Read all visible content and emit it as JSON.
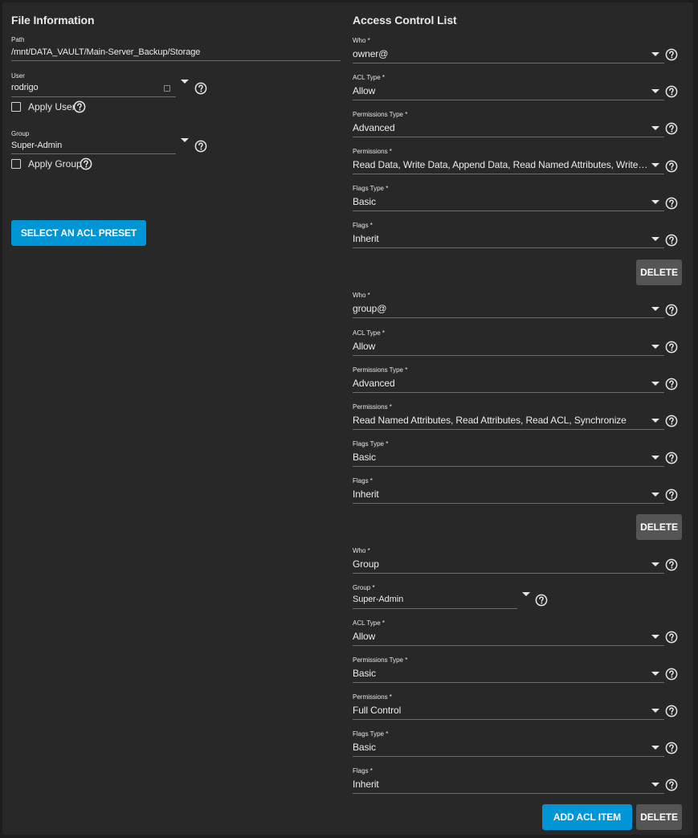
{
  "file_info": {
    "title": "File Information",
    "path_label": "Path",
    "path_value": "/mnt/DATA_VAULT/Main-Server_Backup/Storage",
    "user_label": "User",
    "user_value": "rodrigo",
    "apply_user_label": "Apply User",
    "group_label": "Group",
    "group_value": "Super-Admin",
    "apply_group_label": "Apply Group",
    "preset_button": "SELECT AN ACL PRESET"
  },
  "acl": {
    "title": "Access Control List",
    "labels": {
      "who": "Who *",
      "acl_type": "ACL Type *",
      "perm_type": "Permissions Type *",
      "perms": "Permissions *",
      "flags_type": "Flags Type *",
      "flags": "Flags *",
      "group": "Group *"
    },
    "entries": [
      {
        "who": "owner@",
        "acl_type": "Allow",
        "perm_type": "Advanced",
        "perms": "Read Data, Write Data, Append Data, Read Named Attributes, Write Named Attributes",
        "flags_type": "Basic",
        "flags": "Inherit"
      },
      {
        "who": "group@",
        "acl_type": "Allow",
        "perm_type": "Advanced",
        "perms": "Read Named Attributes, Read Attributes, Read ACL, Synchronize",
        "flags_type": "Basic",
        "flags": "Inherit"
      },
      {
        "who": "Group",
        "group": "Super-Admin",
        "acl_type": "Allow",
        "perm_type": "Basic",
        "perms": "Full Control",
        "flags_type": "Basic",
        "flags": "Inherit"
      }
    ],
    "delete_button": "DELETE",
    "add_button": "ADD ACL ITEM"
  }
}
